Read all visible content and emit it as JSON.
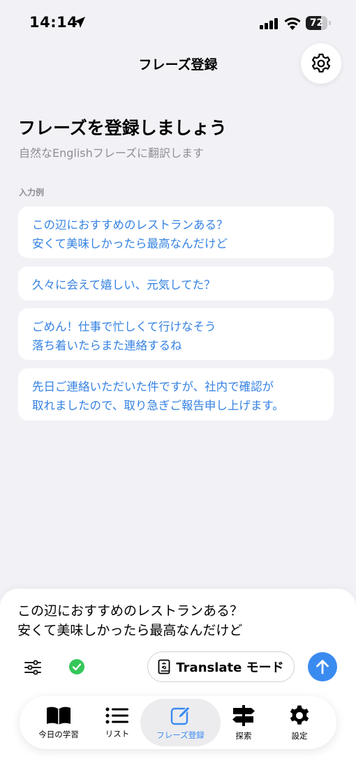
{
  "status_bar": {
    "time": "14:14",
    "battery": "72",
    "battery_level": 0.72
  },
  "nav": {
    "title": "フレーズ登録",
    "settings_icon": "gear-icon"
  },
  "header": {
    "heading": "フレーズを登録しましょう",
    "subheading": "自然なEnglishフレーズに翻訳します"
  },
  "examples": {
    "label": "入力例",
    "items": [
      {
        "lines": [
          "この辺におすすめのレストランある？",
          "安くて美味しかったら最高なんだけど"
        ]
      },
      {
        "lines": [
          "久々に会えて嬉しい、元気してた？"
        ]
      },
      {
        "lines": [
          "ごめん！仕事で忙しくて行けなそう",
          "落ち着いたらまた連絡するね"
        ]
      },
      {
        "lines": [
          "先日ご連絡いただいた件ですが、社内で確認が",
          "取れましたので、取り急ぎご報告申し上げます。"
        ]
      }
    ]
  },
  "composer": {
    "lines": [
      "この辺におすすめのレストランある？",
      "安くて美味しかったら最高なんだけど"
    ],
    "mode_label": "Translate モード",
    "accent_color": "#3a8bf0"
  },
  "tabs": [
    {
      "label": "今日の学習",
      "icon": "book-icon"
    },
    {
      "label": "リスト",
      "icon": "list-icon"
    },
    {
      "label": "フレーズ登録",
      "icon": "edit-icon",
      "active": true
    },
    {
      "label": "探索",
      "icon": "signpost-icon"
    },
    {
      "label": "設定",
      "icon": "gear-icon"
    }
  ]
}
